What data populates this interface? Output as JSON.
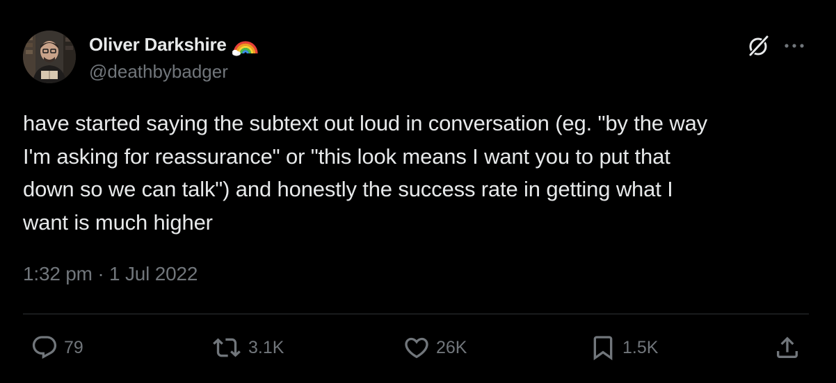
{
  "author": {
    "display_name": "Oliver Darkshire",
    "handle": "@deathbybadger",
    "badge_emoji": "rainbow-emoji"
  },
  "tweet": {
    "text": "have started saying the subtext out loud in conversation (eg. \"by the way\nI'm asking for reassurance\" or \"this look means I want you to put that\ndown so we can talk\") and honestly the success rate in getting what I\nwant is much higher",
    "timestamp": "1:32 pm · 1 Jul 2022"
  },
  "actions": {
    "replies": "79",
    "retweets": "3.1K",
    "likes": "26K",
    "bookmarks": "1.5K"
  },
  "icons": {
    "grok": "grok-icon",
    "more": "more-options-icon",
    "reply": "reply-icon",
    "retweet": "retweet-icon",
    "like": "heart-icon",
    "bookmark": "bookmark-icon",
    "share": "share-icon"
  },
  "colors": {
    "background": "#000000",
    "primary_text": "#e7e9ea",
    "secondary_text": "#71767b",
    "divider": "#2f3336"
  }
}
